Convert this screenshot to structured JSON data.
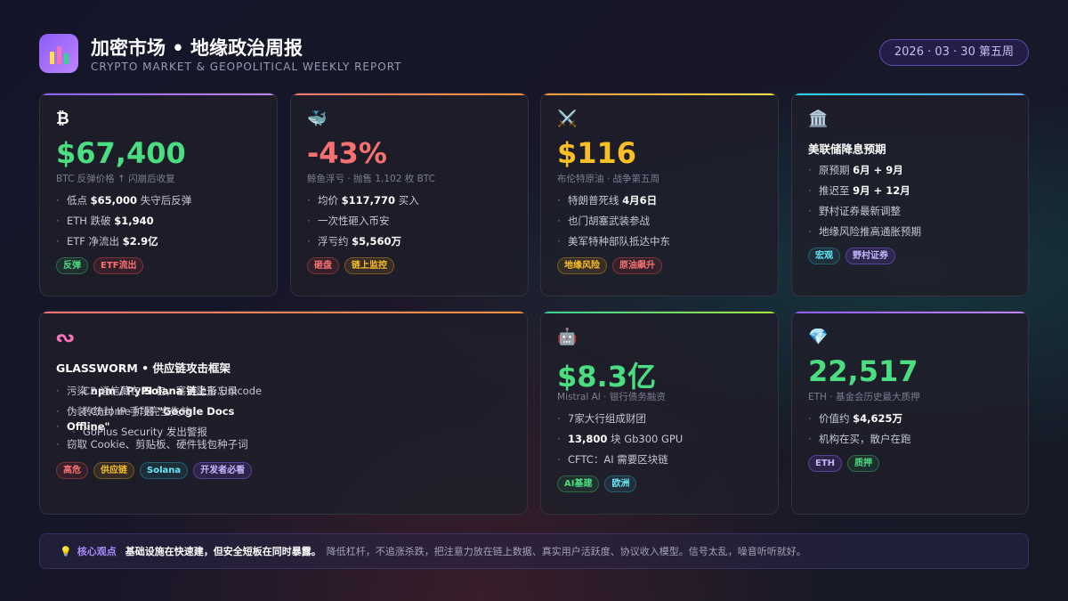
{
  "header": {
    "title": "加密市场 • 地缘政治周报",
    "subtitle": "CRYPTO MARKET & GEOPOLITICAL WEEKLY REPORT",
    "date": "2026 · 03 · 30  第五周"
  },
  "cards": {
    "btc": {
      "icon": "₿",
      "value": "$67,400",
      "caption": "BTC 反弹价格 ↑ 闪崩后收复",
      "items": [
        {
          "pre": "低点 ",
          "bold": "$65,000",
          "post": " 失守后反弹"
        },
        {
          "pre": "ETH 跌破 ",
          "bold": "$1,940",
          "post": ""
        },
        {
          "pre": "ETF 净流出 ",
          "bold": "$2.9亿",
          "post": ""
        }
      ],
      "tags": [
        "反弹",
        "ETF流出"
      ]
    },
    "whale": {
      "icon": "🐳",
      "value": "-43%",
      "caption": "鲸鱼浮亏 · 抛售 1,102 枚 BTC",
      "items": [
        {
          "pre": "均价 ",
          "bold": "$117,770",
          "post": " 买入"
        },
        {
          "pre": "一次性砸入币安",
          "bold": "",
          "post": ""
        },
        {
          "pre": "浮亏约 ",
          "bold": "$5,560万",
          "post": ""
        }
      ],
      "tags": [
        "砸盘",
        "链上监控"
      ]
    },
    "oil": {
      "icon": "⚔️",
      "value": "$116",
      "caption": "布伦特原油 · 战争第五周",
      "items": [
        {
          "pre": "特朗普死线 ",
          "bold": "4月6日",
          "post": ""
        },
        {
          "pre": "也门胡塞武装参战",
          "bold": "",
          "post": ""
        },
        {
          "pre": "美军特种部队抵达中东",
          "bold": "",
          "post": ""
        }
      ],
      "tags": [
        "地缘风险",
        "原油飙升"
      ]
    },
    "fed": {
      "icon": "🏛️",
      "heading": "美联储降息预期",
      "items": [
        {
          "pre": "原预期 ",
          "bold": "6月 + 9月",
          "post": ""
        },
        {
          "pre": "推迟至 ",
          "bold": "9月 + 12月",
          "post": ""
        },
        {
          "pre": "野村证券最新调整",
          "bold": "",
          "post": ""
        },
        {
          "pre": "地缘风险推高通胀预期",
          "bold": "",
          "post": ""
        }
      ],
      "tags": [
        "宏观",
        "野村证券"
      ]
    },
    "glassworm": {
      "icon": "ᔓ",
      "heading": "GLASSWORM • 供应链攻击框架",
      "col1": [
        {
          "pre": "污染 ",
          "bold": "npm / PyPI",
          "post": " 包，塞入隐形 Unicode"
        },
        {
          "pre": "伪装 Chrome 扩展 ",
          "bold": "\"Google Docs",
          "post": ""
        },
        {
          "pre": "",
          "bold": "Offline\"",
          "post": ""
        },
        {
          "pre": "窃取 Cookie、剪贴板、硬件钱包种子词",
          "bold": "",
          "post": ""
        }
      ],
      "col2": [
        {
          "pre": "C2 通信藏在 ",
          "bold": "Solana 链上",
          "post": "备忘录"
        },
        {
          "pre": "传统封 IP 手段完全失效",
          "bold": "",
          "post": ""
        },
        {
          "pre": "GoPlus Security 发出警报",
          "bold": "",
          "post": ""
        }
      ],
      "tags": [
        "高危",
        "供应链",
        "Solana",
        "开发者必看"
      ]
    },
    "mistral": {
      "icon": "🤖",
      "value": "$8.3亿",
      "caption": "Mistral AI · 银行债务融资",
      "items": [
        {
          "pre": "7家大行组成财团",
          "bold": "",
          "post": ""
        },
        {
          "pre": "",
          "bold": "13,800",
          "post": " 块 Gb300 GPU"
        },
        {
          "pre": "CFTC：AI 需要区块链",
          "bold": "",
          "post": ""
        }
      ],
      "tags": [
        "AI基建",
        "欧洲"
      ]
    },
    "eth": {
      "icon": "💎",
      "value": "22,517",
      "caption": "ETH · 基金会历史最大质押",
      "items": [
        {
          "pre": "价值约 ",
          "bold": "$4,625万",
          "post": ""
        },
        {
          "pre": "机构在买，散户在跑",
          "bold": "",
          "post": ""
        }
      ],
      "tags": [
        "ETH",
        "质押"
      ]
    }
  },
  "footer": {
    "icon": "💡",
    "label": "核心观点",
    "strong": "基础设施在快速建，但安全短板在同时暴露。",
    "rest": "降低杠杆，不追涨杀跌，把注意力放在链上数据、真实用户活跃度、协议收入模型。信号太乱，噪音听听就好。"
  },
  "colors": {
    "green": "#4ade80",
    "red": "#f87171",
    "orange": "#fbbf24",
    "accent": "#8b5cf6"
  }
}
